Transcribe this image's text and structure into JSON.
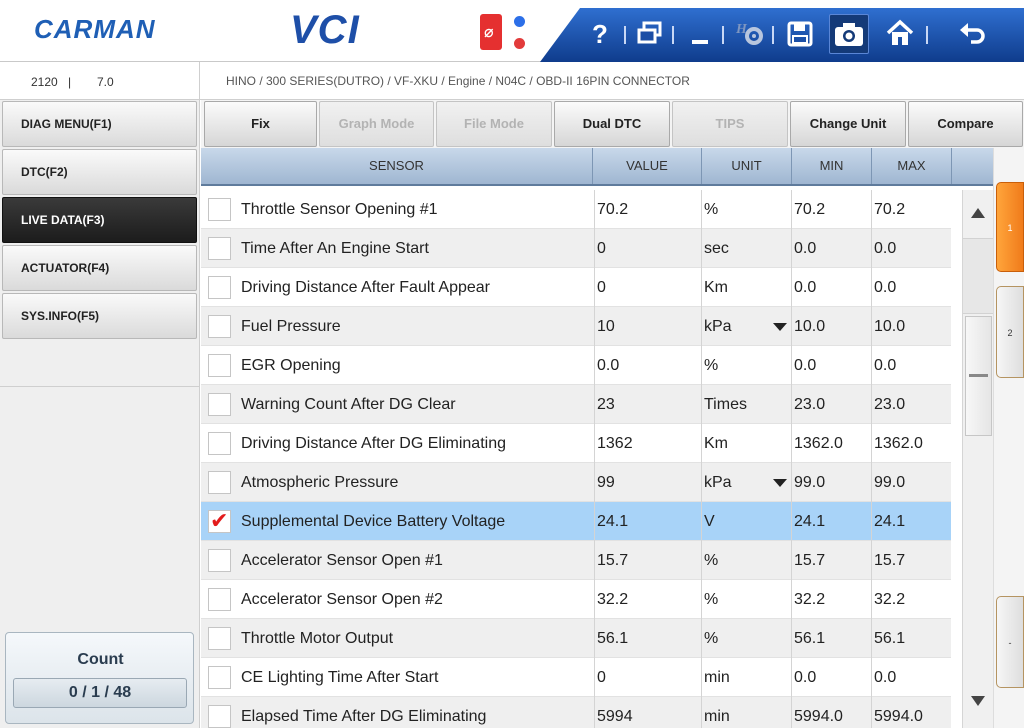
{
  "header": {
    "brand": "CARMAN",
    "product": "VCI",
    "toolbar": {
      "help_icon_glyph": "?",
      "home_icon_glyph": "⌂",
      "back_icon_glyph": "↶"
    }
  },
  "status": {
    "code": "2120",
    "separator": "|",
    "version": "7.0",
    "breadcrumb": "HINO / 300 SERIES(DUTRO) / VF-XKU / Engine / N04C / OBD-II 16PIN CONNECTOR"
  },
  "sidebar": {
    "items": [
      {
        "label": "DIAG MENU(F1)"
      },
      {
        "label": "DTC(F2)"
      },
      {
        "label": "LIVE DATA(F3)"
      },
      {
        "label": "ACTUATOR(F4)"
      },
      {
        "label": "SYS.INFO(F5)"
      }
    ],
    "count_label": "Count",
    "count_value": "0 / 1 / 48"
  },
  "functions": [
    {
      "label": "Fix",
      "enabled": true
    },
    {
      "label": "Graph Mode",
      "enabled": false
    },
    {
      "label": "File Mode",
      "enabled": false
    },
    {
      "label": "Dual DTC",
      "enabled": true
    },
    {
      "label": "TIPS",
      "enabled": false
    },
    {
      "label": "Change Unit",
      "enabled": true
    },
    {
      "label": "Compare",
      "enabled": true
    }
  ],
  "table": {
    "headers": {
      "sensor": "SENSOR",
      "value": "VALUE",
      "unit": "UNIT",
      "min": "MIN",
      "max": "MAX"
    },
    "rows": [
      {
        "name": "Throttle Sensor Opening #1",
        "value": "70.2",
        "unit": "%",
        "min": "70.2",
        "max": "70.2",
        "checked": false,
        "dropdown": false
      },
      {
        "name": "Time After An Engine Start",
        "value": "0",
        "unit": "sec",
        "min": "0.0",
        "max": "0.0",
        "checked": false,
        "dropdown": false
      },
      {
        "name": "Driving Distance After Fault Appear",
        "value": "0",
        "unit": "Km",
        "min": "0.0",
        "max": "0.0",
        "checked": false,
        "dropdown": false
      },
      {
        "name": "Fuel Pressure",
        "value": "10",
        "unit": "kPa",
        "min": "10.0",
        "max": "10.0",
        "checked": false,
        "dropdown": true
      },
      {
        "name": "EGR Opening",
        "value": "0.0",
        "unit": "%",
        "min": "0.0",
        "max": "0.0",
        "checked": false,
        "dropdown": false
      },
      {
        "name": "Warning Count After DG Clear",
        "value": "23",
        "unit": "Times",
        "min": "23.0",
        "max": "23.0",
        "checked": false,
        "dropdown": false
      },
      {
        "name": "Driving Distance After DG Eliminating",
        "value": "1362",
        "unit": "Km",
        "min": "1362.0",
        "max": "1362.0",
        "checked": false,
        "dropdown": false
      },
      {
        "name": "Atmospheric Pressure",
        "value": "99",
        "unit": "kPa",
        "min": "99.0",
        "max": "99.0",
        "checked": false,
        "dropdown": true
      },
      {
        "name": "Supplemental Device Battery Voltage",
        "value": "24.1",
        "unit": "V",
        "min": "24.1",
        "max": "24.1",
        "checked": true,
        "dropdown": false
      },
      {
        "name": "Accelerator Sensor Open #1",
        "value": "15.7",
        "unit": "%",
        "min": "15.7",
        "max": "15.7",
        "checked": false,
        "dropdown": false
      },
      {
        "name": "Accelerator Sensor Open #2",
        "value": "32.2",
        "unit": "%",
        "min": "32.2",
        "max": "32.2",
        "checked": false,
        "dropdown": false
      },
      {
        "name": "Throttle Motor Output",
        "value": "56.1",
        "unit": "%",
        "min": "56.1",
        "max": "56.1",
        "checked": false,
        "dropdown": false
      },
      {
        "name": "CE Lighting Time After Start",
        "value": "0",
        "unit": "min",
        "min": "0.0",
        "max": "0.0",
        "checked": false,
        "dropdown": false
      },
      {
        "name": "Elapsed Time After DG Eliminating",
        "value": "5994",
        "unit": "min",
        "min": "5994.0",
        "max": "5994.0",
        "checked": false,
        "dropdown": false
      }
    ]
  },
  "pages": [
    {
      "label": "1"
    },
    {
      "label": "2"
    },
    {
      "label": "-"
    }
  ],
  "colors": {
    "accent": "#1f5fb5",
    "selected_row": "#a8d3f8",
    "active_tab": "#f07b1b"
  }
}
